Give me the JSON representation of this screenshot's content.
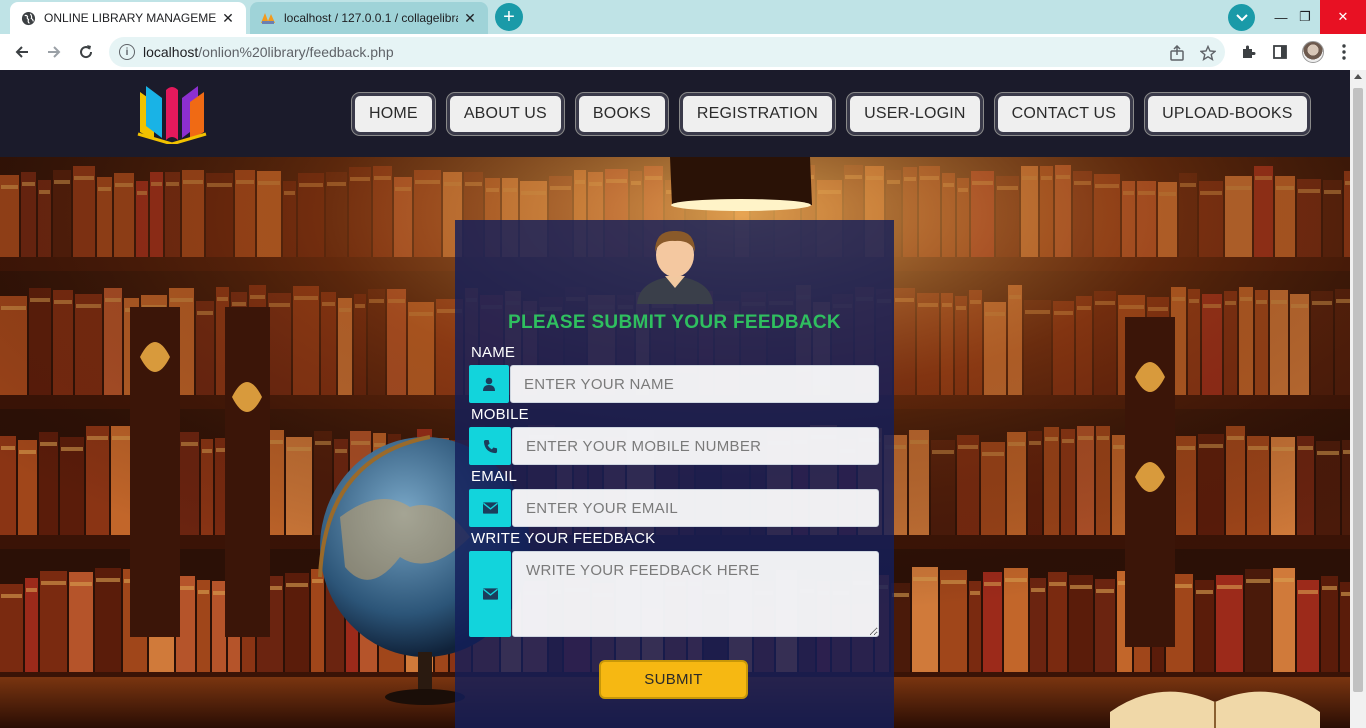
{
  "browser": {
    "tabs": [
      {
        "title": "ONLINE LIBRARY MANAGEMENT",
        "active": true
      },
      {
        "title": "localhost / 127.0.0.1 / collagelibra",
        "active": false
      }
    ],
    "url_host": "localhost",
    "url_path": "/onlion%20library/feedback.php"
  },
  "nav": {
    "items": [
      "HOME",
      "ABOUT US",
      "BOOKS",
      "REGISTRATION",
      "USER-LOGIN",
      "CONTACT US",
      "UPLOAD-BOOKS"
    ]
  },
  "form": {
    "title": "PLEASE SUBMIT YOUR FEEDBACK",
    "name_label": "NAME",
    "name_placeholder": "ENTER YOUR NAME",
    "mobile_label": "MOBILE",
    "mobile_placeholder": "ENTER YOUR MOBILE NUMBER",
    "email_label": "EMAIL",
    "email_placeholder": "ENTER YOUR EMAIL",
    "feedback_label": "WRITE YOUR FEEDBACK",
    "feedback_placeholder": "WRITE YOUR FEEDBACK HERE",
    "submit_label": "SUBMIT"
  },
  "icons": {
    "name": "user-icon",
    "mobile": "phone-icon",
    "email": "envelope-icon",
    "feedback": "envelope-icon"
  },
  "colors": {
    "header_bg": "#1b1b2b",
    "card_bg": "#141e5a",
    "title_green": "#2fbf5f",
    "icon_cyan": "#12d4dc",
    "submit_yellow": "#f6b812"
  }
}
